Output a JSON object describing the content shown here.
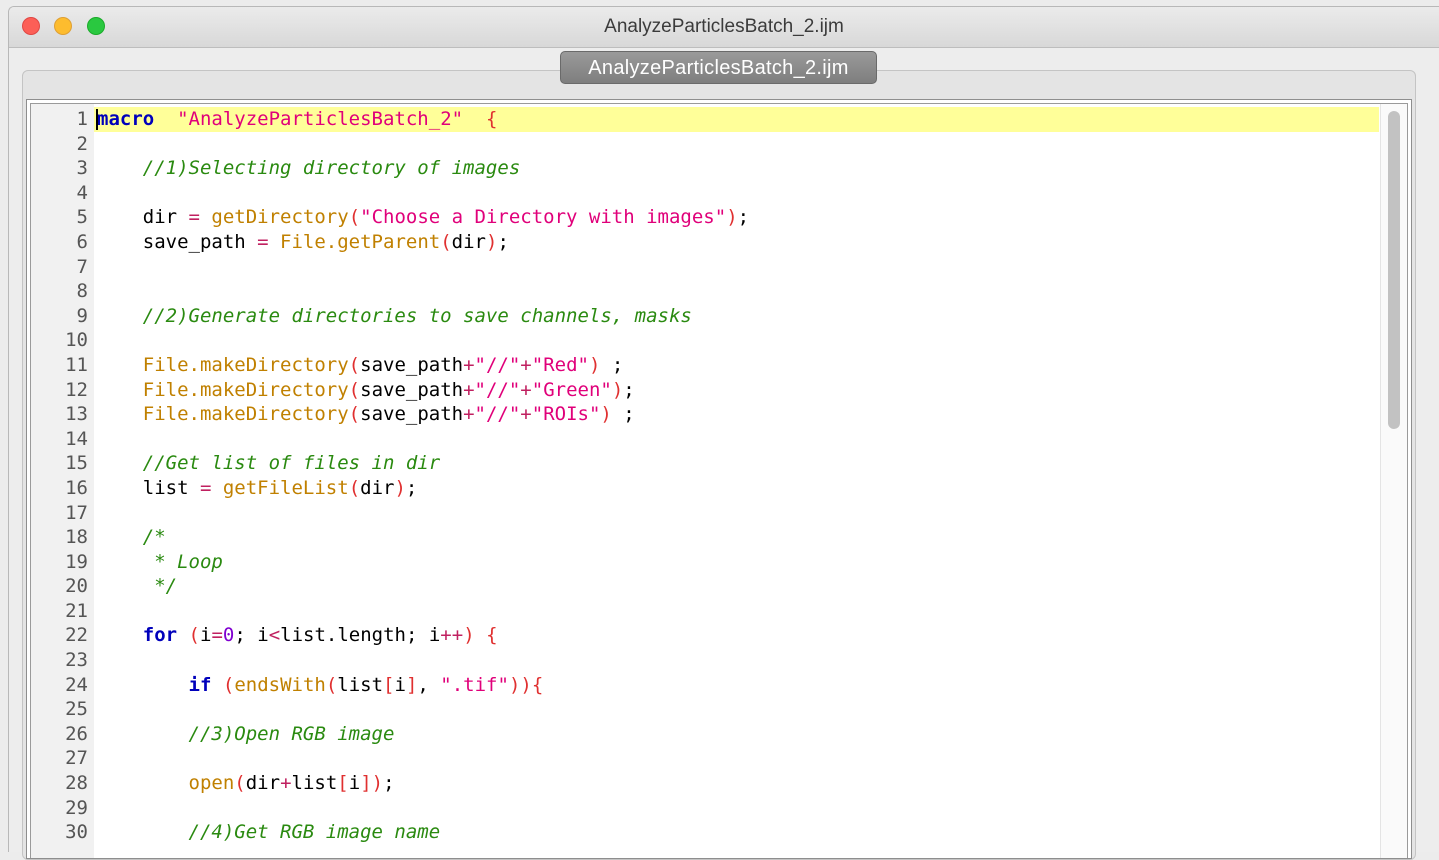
{
  "window": {
    "title": "AnalyzeParticlesBatch_2.ijm"
  },
  "tab": {
    "label": "AnalyzeParticlesBatch_2.ijm"
  },
  "editor": {
    "lines": [
      {
        "n": "1",
        "tokens": [
          [
            "kw",
            "macro"
          ],
          [
            "",
            "  "
          ],
          [
            "str",
            "\"AnalyzeParticlesBatch_2\""
          ],
          [
            "",
            "  "
          ],
          [
            "pr",
            "{"
          ]
        ]
      },
      {
        "n": "2",
        "tokens": []
      },
      {
        "n": "3",
        "tokens": [
          [
            "",
            "    "
          ],
          [
            "cm",
            "//1)Selecting directory of images"
          ]
        ]
      },
      {
        "n": "4",
        "tokens": []
      },
      {
        "n": "5",
        "tokens": [
          [
            "",
            "    dir "
          ],
          [
            "op",
            "="
          ],
          [
            "",
            ""
          ],
          [
            "fn",
            " getDirectory"
          ],
          [
            "pr",
            "("
          ],
          [
            "str",
            "\"Choose a Directory with images\""
          ],
          [
            "pr",
            ")"
          ],
          [
            "",
            ";"
          ]
        ]
      },
      {
        "n": "6",
        "tokens": [
          [
            "",
            "    save_path "
          ],
          [
            "op",
            "="
          ],
          [
            "fn",
            " File.getParent"
          ],
          [
            "pr",
            "("
          ],
          [
            "",
            "dir"
          ],
          [
            "pr",
            ")"
          ],
          [
            "",
            ";"
          ]
        ]
      },
      {
        "n": "7",
        "tokens": []
      },
      {
        "n": "8",
        "tokens": []
      },
      {
        "n": "9",
        "tokens": [
          [
            "",
            "    "
          ],
          [
            "cm",
            "//2)Generate directories to save channels, masks"
          ]
        ]
      },
      {
        "n": "10",
        "tokens": []
      },
      {
        "n": "11",
        "tokens": [
          [
            "",
            "    "
          ],
          [
            "fn",
            "File.makeDirectory"
          ],
          [
            "pr",
            "("
          ],
          [
            "",
            "save_path"
          ],
          [
            "op",
            "+"
          ],
          [
            "str",
            "\"//\""
          ],
          [
            "op",
            "+"
          ],
          [
            "str",
            "\"Red\""
          ],
          [
            "pr",
            ")"
          ],
          [
            "",
            " ;"
          ]
        ]
      },
      {
        "n": "12",
        "tokens": [
          [
            "",
            "    "
          ],
          [
            "fn",
            "File.makeDirectory"
          ],
          [
            "pr",
            "("
          ],
          [
            "",
            "save_path"
          ],
          [
            "op",
            "+"
          ],
          [
            "str",
            "\"//\""
          ],
          [
            "op",
            "+"
          ],
          [
            "str",
            "\"Green\""
          ],
          [
            "pr",
            ")"
          ],
          [
            "",
            ";"
          ]
        ]
      },
      {
        "n": "13",
        "tokens": [
          [
            "",
            "    "
          ],
          [
            "fn",
            "File.makeDirectory"
          ],
          [
            "pr",
            "("
          ],
          [
            "",
            "save_path"
          ],
          [
            "op",
            "+"
          ],
          [
            "str",
            "\"//\""
          ],
          [
            "op",
            "+"
          ],
          [
            "str",
            "\"ROIs\""
          ],
          [
            "pr",
            ")"
          ],
          [
            "",
            " ;"
          ]
        ]
      },
      {
        "n": "14",
        "tokens": []
      },
      {
        "n": "15",
        "tokens": [
          [
            "",
            "    "
          ],
          [
            "cm",
            "//Get list of files in dir"
          ]
        ]
      },
      {
        "n": "16",
        "tokens": [
          [
            "",
            "    list "
          ],
          [
            "op",
            "="
          ],
          [
            "fn",
            " getFileList"
          ],
          [
            "pr",
            "("
          ],
          [
            "",
            "dir"
          ],
          [
            "pr",
            ")"
          ],
          [
            "",
            ";"
          ]
        ]
      },
      {
        "n": "17",
        "tokens": []
      },
      {
        "n": "18",
        "tokens": [
          [
            "",
            "    "
          ],
          [
            "cm",
            "/*"
          ]
        ]
      },
      {
        "n": "19",
        "tokens": [
          [
            "",
            "     "
          ],
          [
            "cm",
            "* Loop"
          ]
        ]
      },
      {
        "n": "20",
        "tokens": [
          [
            "",
            "     "
          ],
          [
            "cm",
            "*/"
          ]
        ]
      },
      {
        "n": "21",
        "tokens": []
      },
      {
        "n": "22",
        "tokens": [
          [
            "",
            "    "
          ],
          [
            "kw",
            "for"
          ],
          [
            "",
            " "
          ],
          [
            "pr",
            "("
          ],
          [
            "",
            "i"
          ],
          [
            "op",
            "="
          ],
          [
            "num",
            "0"
          ],
          [
            "",
            "; i"
          ],
          [
            "op",
            "<"
          ],
          [
            "",
            "list.length; i"
          ],
          [
            "op",
            "++"
          ],
          [
            "pr",
            ")"
          ],
          [
            "",
            " "
          ],
          [
            "pr",
            "{"
          ]
        ]
      },
      {
        "n": "23",
        "tokens": []
      },
      {
        "n": "24",
        "tokens": [
          [
            "",
            "        "
          ],
          [
            "kw",
            "if"
          ],
          [
            "",
            " "
          ],
          [
            "pr",
            "("
          ],
          [
            "fn",
            "endsWith"
          ],
          [
            "pr",
            "("
          ],
          [
            "",
            "list"
          ],
          [
            "pr",
            "["
          ],
          [
            "",
            "i"
          ],
          [
            "pr",
            "]"
          ],
          [
            "",
            ", "
          ],
          [
            "str",
            "\".tif\""
          ],
          [
            "pr",
            "))"
          ],
          [
            "pr",
            "{"
          ]
        ]
      },
      {
        "n": "25",
        "tokens": []
      },
      {
        "n": "26",
        "tokens": [
          [
            "",
            "        "
          ],
          [
            "cm",
            "//3)Open RGB image"
          ]
        ]
      },
      {
        "n": "27",
        "tokens": []
      },
      {
        "n": "28",
        "tokens": [
          [
            "",
            "        "
          ],
          [
            "fn",
            "open"
          ],
          [
            "pr",
            "("
          ],
          [
            "",
            "dir"
          ],
          [
            "op",
            "+"
          ],
          [
            "",
            "list"
          ],
          [
            "pr",
            "["
          ],
          [
            "",
            "i"
          ],
          [
            "pr",
            "])"
          ],
          [
            "",
            ";"
          ]
        ]
      },
      {
        "n": "29",
        "tokens": []
      },
      {
        "n": "30",
        "tokens": [
          [
            "",
            "        "
          ],
          [
            "cm",
            "//4)Get RGB image name"
          ]
        ]
      }
    ]
  },
  "colors": {
    "current_line": "#ffff99",
    "keyword": "#0000bb",
    "string": "#e0007a",
    "function": "#c08000",
    "comment": "#2a8a10"
  }
}
